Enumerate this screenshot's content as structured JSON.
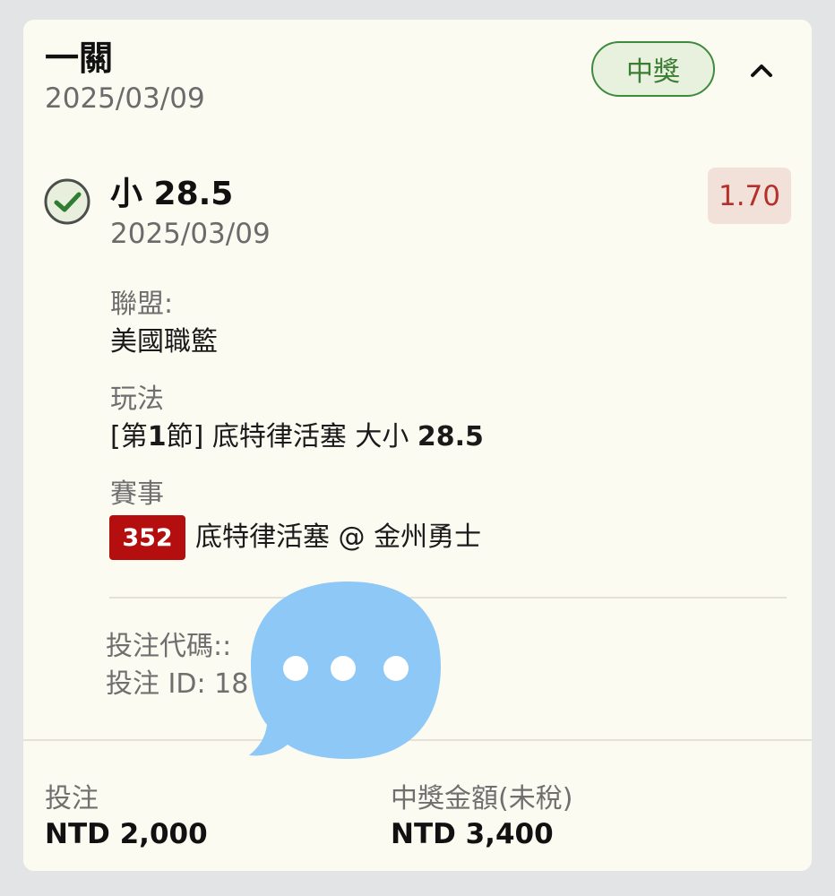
{
  "header": {
    "bet_type": "一關",
    "date": "2025/03/09",
    "status_badge": "中獎",
    "collapse_icon": "chevron-up-icon"
  },
  "selection": {
    "status_icon": "check-circle-icon",
    "name": "小 28.5",
    "date": "2025/03/09",
    "odds": "1.70",
    "league_label": "聯盟:",
    "league_value": "美國職籃",
    "market_label": "玩法",
    "market_prefix": "[第",
    "market_period": "1",
    "market_mid": "節] 底特律活塞 大小 ",
    "market_line": "28.5",
    "event_label": "賽事",
    "event_code": "352",
    "event_name": "底特律活塞 @ 金州勇士"
  },
  "bet_info": {
    "code_label": "投注代碼::",
    "id_label": "投注 ID: 18"
  },
  "summary": {
    "stake_label": "投注",
    "stake_value": "NTD 2,000",
    "payout_label": "中獎金額(未稅)",
    "payout_value": "NTD 3,400"
  },
  "overlay": {
    "icon": "chat-bubble-icon"
  },
  "colors": {
    "page_bg": "#e3e4e6",
    "card_bg": "#fcfbf2",
    "win_green": "#3b7d32",
    "odds_red": "#b5302b",
    "event_code_bg": "#b50e0e",
    "bubble_blue": "#8ec8f6"
  }
}
